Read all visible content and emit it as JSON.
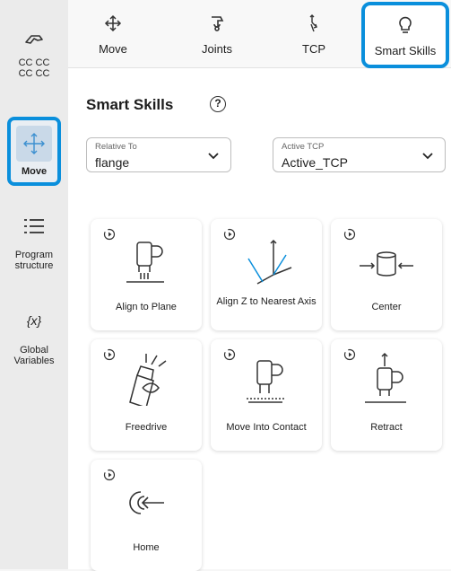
{
  "sidebar": {
    "items": [
      {
        "label": "CC CC\nCC CC"
      },
      {
        "label": "Move",
        "active": true
      },
      {
        "label": "Program\nstructure"
      },
      {
        "label": "{x}"
      },
      {
        "label": "Global\nVariables"
      }
    ]
  },
  "tabs": [
    {
      "label": "Move"
    },
    {
      "label": "Joints"
    },
    {
      "label": "TCP"
    },
    {
      "label": "Smart Skills",
      "active": true
    }
  ],
  "panel": {
    "title": "Smart Skills",
    "help": "?",
    "relative_to": {
      "label": "Relative To",
      "value": "flange"
    },
    "active_tcp": {
      "label": "Active TCP",
      "value": "Active_TCP"
    }
  },
  "skills": [
    {
      "label": "Align to Plane"
    },
    {
      "label": "Align Z to Nearest Axis"
    },
    {
      "label": "Center"
    },
    {
      "label": "Freedrive"
    },
    {
      "label": "Move Into Contact"
    },
    {
      "label": "Retract"
    },
    {
      "label": "Home"
    }
  ],
  "colors": {
    "accent": "#0a8fdc",
    "sidebar_bg": "#ebebeb",
    "panel_bg": "#ffffff"
  }
}
